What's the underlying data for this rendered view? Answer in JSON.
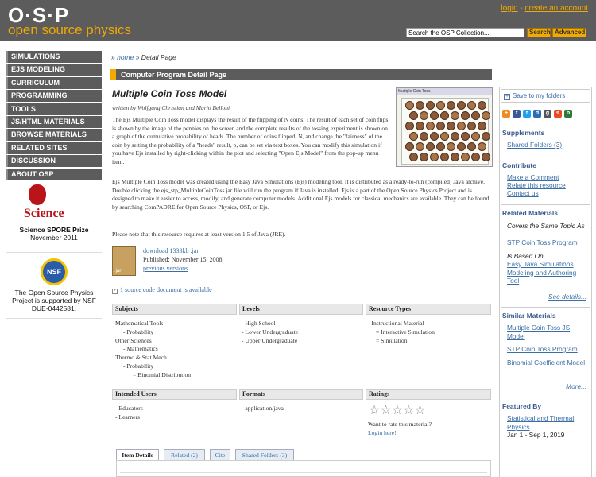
{
  "header": {
    "logo_text": "O·S·P",
    "logo_sub": "open source physics",
    "login": "login",
    "separator": " - ",
    "create_account": "create an account",
    "search_value": "Search the OSP Collection...",
    "search_label": "Search",
    "advanced_label": "Advanced"
  },
  "leftnav": {
    "items": [
      "SIMULATIONS",
      "EJS MODELING",
      "CURRICULUM",
      "PROGRAMMING",
      "TOOLS",
      "JS/HTML MATERIALS",
      "BROWSE MATERIALS",
      "RELATED SITES",
      "DISCUSSION",
      "ABOUT OSP"
    ]
  },
  "science": {
    "logo_word": "Science",
    "prize": "Science SPORE Prize",
    "date": "November 2011"
  },
  "nsf": {
    "logo": "NSF",
    "line1": "The Open Source Physics",
    "line2": "Project is supported by NSF",
    "line3": "DUE-0442581."
  },
  "breadcrumb": {
    "prefix": "» ",
    "home": "home",
    "rest": " » Detail Page"
  },
  "detail_bar": "Computer Program Detail Page",
  "resource": {
    "title": "Multiple Coin Toss Model",
    "byline": "written by Wolfgang Christian and Mario Belloni",
    "p1": "The Ejs Multiple Coin Toss model displays the result of the flipping of N coins.  The result of each set of coin flips is shown by the image of the pennies on the screen and the complete results of the tossing experiment is shown on a graph of the cumulative probability of heads.  The number of coins flipped, N, and change the \"fairness\" of the coin by setting the probability of a \"heads\" result, p, can be set via text boxes.  You can modify this simulation if you have Ejs installed by right-clicking within the plot and selecting \"Open Ejs Model\" from the pop-up menu item.",
    "p2": "Ejs Multiple Coin Toss model was created using the Easy Java Simulations (Ejs) modeling tool.  It is distributed as a ready-to-run (compiled) Java archive.  Double clicking the ejs_stp_MultipleCoinToss.jar file will run the program if Java is installed.  Ejs is a part of the Open Source Physics Project and is designed to make it easier to access, modify, and generate computer models.  Additional Ejs models for classical mechanics are available.  They can be found by searching ComPADRE for Open Source Physics, OSP, or Ejs.",
    "p3": "Please note that this resource requires at least version 1.5 of Java (JRE).",
    "screenshot_title": "Multiple Coin Toss",
    "jar_label": ".jar",
    "download": "download 1333kb .jar",
    "published": "Published: November 15, 2008",
    "previous_versions": "previous versions",
    "source_doc_plus": "+",
    "source_doc": "1 source code document is available"
  },
  "columns": {
    "subjects": {
      "title": "Subjects",
      "items": [
        {
          "text": "Mathematical Tools",
          "level": 0
        },
        {
          "text": "- Probability",
          "level": 1
        },
        {
          "text": "Other Sciences",
          "level": 0
        },
        {
          "text": "- Mathematics",
          "level": 1
        },
        {
          "text": "Thermo & Stat Mech",
          "level": 0
        },
        {
          "text": "- Probability",
          "level": 1
        },
        {
          "text": "= Binomial Distribution",
          "level": 2
        }
      ]
    },
    "levels": {
      "title": "Levels",
      "items": [
        "- High School",
        "- Lower Undergraduate",
        "- Upper Undergraduate"
      ]
    },
    "resource_types": {
      "title": "Resource Types",
      "items": [
        {
          "text": "- Instructional Material",
          "level": 0
        },
        {
          "text": "= Interactive Simulation",
          "level": 2
        },
        {
          "text": "= Simulation",
          "level": 2
        }
      ]
    },
    "audience": {
      "title": "Intended Users",
      "items": [
        "- Educators",
        "- Learners"
      ]
    },
    "formats": {
      "title": "Formats",
      "items": [
        "- application/java"
      ]
    },
    "ratings": {
      "title": "Ratings",
      "rating": 0,
      "max": 5,
      "prompt": "Want to rate this material?",
      "login": "Login here!"
    }
  },
  "tabs": [
    "Item Details",
    "Related (2)",
    "Cite",
    "Shared Folders (3)"
  ],
  "right": {
    "save_plus": "+",
    "save": "Save to my folders",
    "supplements_title": "Supplements",
    "shared_folders": "Shared Folders (3)",
    "contribute_title": "Contribute",
    "contribute_links": [
      "Make a Comment",
      "Relate this resource",
      "Contact us"
    ],
    "related_title": "Related Materials",
    "related_1_label": "Covers the Same Topic As",
    "related_1_link": "STP Coin Toss Program",
    "related_2_label": "Is Based On",
    "related_2_link": "Easy Java Simulations Modeling and Authoring Tool",
    "see_details": "See details...",
    "similar_title": "Similar Materials",
    "similar_links": [
      "Multiple Coin Toss JS Model",
      "STP Coin Toss Program",
      "Binomial Coefficient Model"
    ],
    "more": "More...",
    "featured_title": "Featured By",
    "featured_link": "Statistical and Thermal Physics",
    "featured_dates": "Jan 1 - Sep 1, 2019"
  },
  "colors": {
    "header_gray": "#5c5c5c",
    "accent_orange": "#f2a900",
    "link_blue": "#3a6ea5"
  }
}
